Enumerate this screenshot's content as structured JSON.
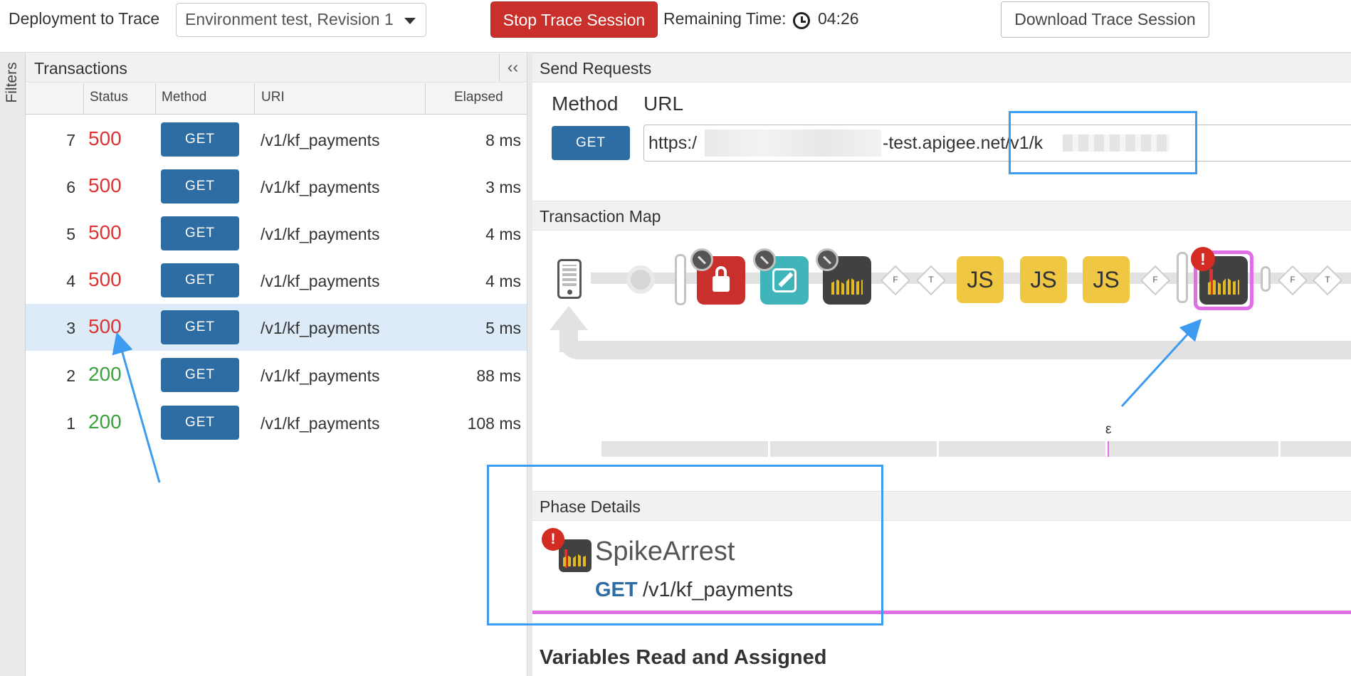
{
  "toolbar": {
    "deployment_label": "Deployment to Trace",
    "deployment_selected": "Environment test, Revision 1",
    "stop_label": "Stop Trace Session",
    "remaining_label": "Remaining Time:",
    "remaining_value": "04:26",
    "download_label": "Download Trace Session"
  },
  "filters": {
    "label": "Filters"
  },
  "transactions": {
    "title": "Transactions",
    "collapse_glyph": "‹‹",
    "columns": [
      "Status",
      "Method",
      "URI",
      "Elapsed"
    ],
    "rows": [
      {
        "idx": "7",
        "status": "500",
        "method": "GET",
        "uri": "/v1/kf_payments",
        "elapsed": "8 ms"
      },
      {
        "idx": "6",
        "status": "500",
        "method": "GET",
        "uri": "/v1/kf_payments",
        "elapsed": "3 ms"
      },
      {
        "idx": "5",
        "status": "500",
        "method": "GET",
        "uri": "/v1/kf_payments",
        "elapsed": "4 ms"
      },
      {
        "idx": "4",
        "status": "500",
        "method": "GET",
        "uri": "/v1/kf_payments",
        "elapsed": "4 ms"
      },
      {
        "idx": "3",
        "status": "500",
        "method": "GET",
        "uri": "/v1/kf_payments",
        "elapsed": "5 ms"
      },
      {
        "idx": "2",
        "status": "200",
        "method": "GET",
        "uri": "/v1/kf_payments",
        "elapsed": "88 ms"
      },
      {
        "idx": "1",
        "status": "200",
        "method": "GET",
        "uri": "/v1/kf_payments",
        "elapsed": "108 ms"
      }
    ],
    "selected_idx": "3"
  },
  "send_requests": {
    "title": "Send Requests",
    "method_label": "Method",
    "url_label": "URL",
    "method_value": "GET",
    "url_prefix": "https:/",
    "url_visible_mid": "-test.apigee.net/v1/k"
  },
  "transaction_map": {
    "title": "Transaction Map",
    "js_label": "JS",
    "cond_f": "F",
    "cond_t": "T",
    "timeline_marker_label": "ε",
    "colors": {
      "lock": "#c9302c",
      "edit": "#3fb5b9",
      "spike": "#414141",
      "js": "#f0c742",
      "selected": "#e16ee6",
      "error": "#d42b22"
    }
  },
  "phase_details": {
    "title": "Phase Details",
    "error_glyph": "!",
    "policy_name": "SpikeArrest",
    "method": "GET",
    "path": "/v1/kf_payments"
  },
  "variables": {
    "title": "Variables Read and Assigned"
  }
}
